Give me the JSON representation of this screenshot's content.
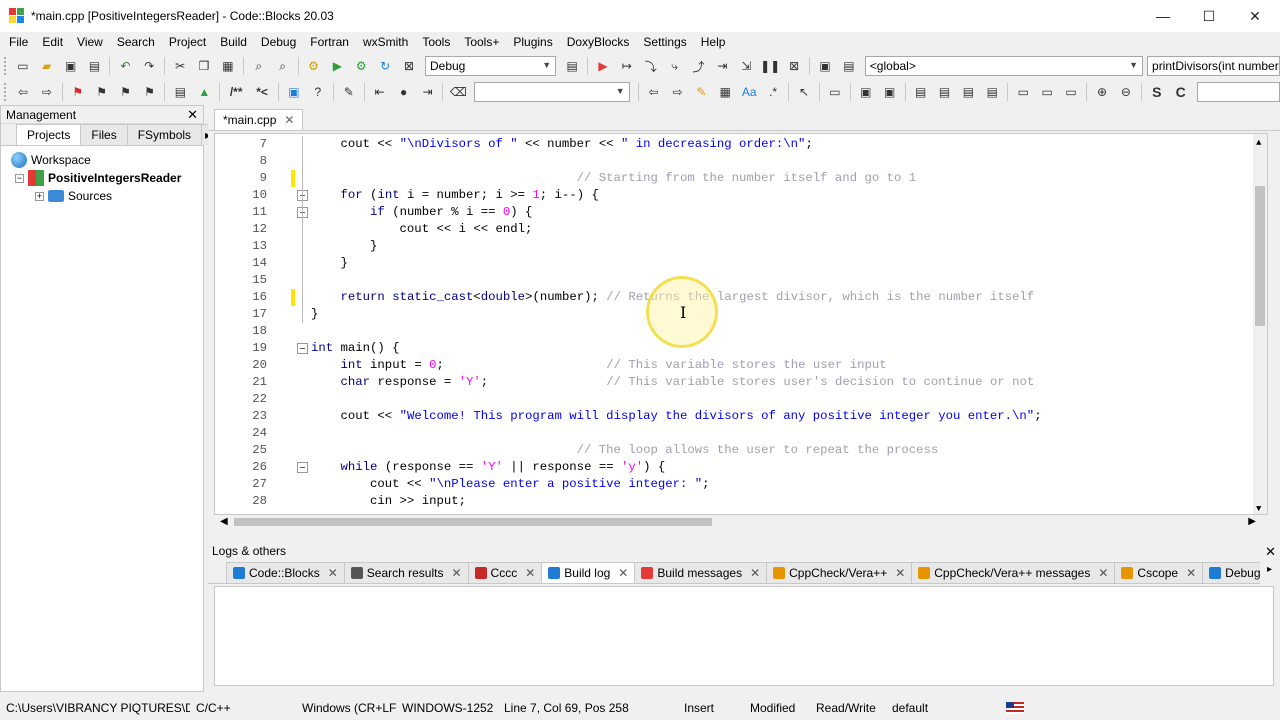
{
  "window": {
    "title": "*main.cpp [PositiveIntegersReader] - Code::Blocks 20.03",
    "controls": {
      "minimize": "—",
      "maximize": "☐",
      "close": "✕"
    }
  },
  "menu": [
    "File",
    "Edit",
    "View",
    "Search",
    "Project",
    "Build",
    "Debug",
    "Fortran",
    "wxSmith",
    "Tools",
    "Tools+",
    "Plugins",
    "DoxyBlocks",
    "Settings",
    "Help"
  ],
  "toolbar": {
    "build_target": "Debug",
    "scope": "<global>",
    "function": "printDivisors(int number",
    "doxy_comment_block": "/**",
    "doxy_comment_line": "*<"
  },
  "management": {
    "title": "Management",
    "tabs": [
      "Projects",
      "Files",
      "FSymbols"
    ],
    "tree": {
      "workspace": "Workspace",
      "project": "PositiveIntegersReader",
      "sources": "Sources"
    }
  },
  "editor": {
    "file_tab": "*main.cpp",
    "lines": [
      {
        "n": "7",
        "code": "    cout << \"\\nDivisors of \" << number << \" in decreasing order:\\n\";"
      },
      {
        "n": "8",
        "code": ""
      },
      {
        "n": "9",
        "code": "                                    // Starting from the number itself and go to 1"
      },
      {
        "n": "10",
        "code": "    for (int i = number; i >= 1; i--) {"
      },
      {
        "n": "11",
        "code": "        if (number % i == 0) {"
      },
      {
        "n": "12",
        "code": "            cout << i << endl;"
      },
      {
        "n": "13",
        "code": "        }"
      },
      {
        "n": "14",
        "code": "    }"
      },
      {
        "n": "15",
        "code": ""
      },
      {
        "n": "16",
        "code": "    return static_cast<double>(number); // Returns the largest divisor, which is the number itself"
      },
      {
        "n": "17",
        "code": "}"
      },
      {
        "n": "18",
        "code": ""
      },
      {
        "n": "19",
        "code": "int main() {"
      },
      {
        "n": "20",
        "code": "    int input = 0;                      // This variable stores the user input"
      },
      {
        "n": "21",
        "code": "    char response = 'Y';                // This variable stores user's decision to continue or not"
      },
      {
        "n": "22",
        "code": ""
      },
      {
        "n": "23",
        "code": "    cout << \"Welcome! This program will display the divisors of any positive integer you enter.\\n\";"
      },
      {
        "n": "24",
        "code": ""
      },
      {
        "n": "25",
        "code": "                                    // The loop allows the user to repeat the process"
      },
      {
        "n": "26",
        "code": "    while (response == 'Y' || response == 'y') {"
      },
      {
        "n": "27",
        "code": "        cout << \"\\nPlease enter a positive integer: \";"
      },
      {
        "n": "28",
        "code": "        cin >> input;"
      }
    ]
  },
  "logs": {
    "title": "Logs & others",
    "tabs": [
      "Code::Blocks",
      "Search results",
      "Cccc",
      "Build log",
      "Build messages",
      "CppCheck/Vera++",
      "CppCheck/Vera++ messages",
      "Cscope",
      "Debugger"
    ]
  },
  "statusbar": {
    "path": "C:\\Users\\VIBRANCY PIQTURES\\Desktop\\School Work\\C++\\CW\\PF_C...",
    "language": "C/C++",
    "line_endings": "Windows (CR+LF)",
    "encoding": "WINDOWS-1252",
    "position": "Line 7, Col 69, Pos 258",
    "mode": "Insert",
    "modified": "Modified",
    "access": "Read/Write",
    "profile": "default"
  }
}
